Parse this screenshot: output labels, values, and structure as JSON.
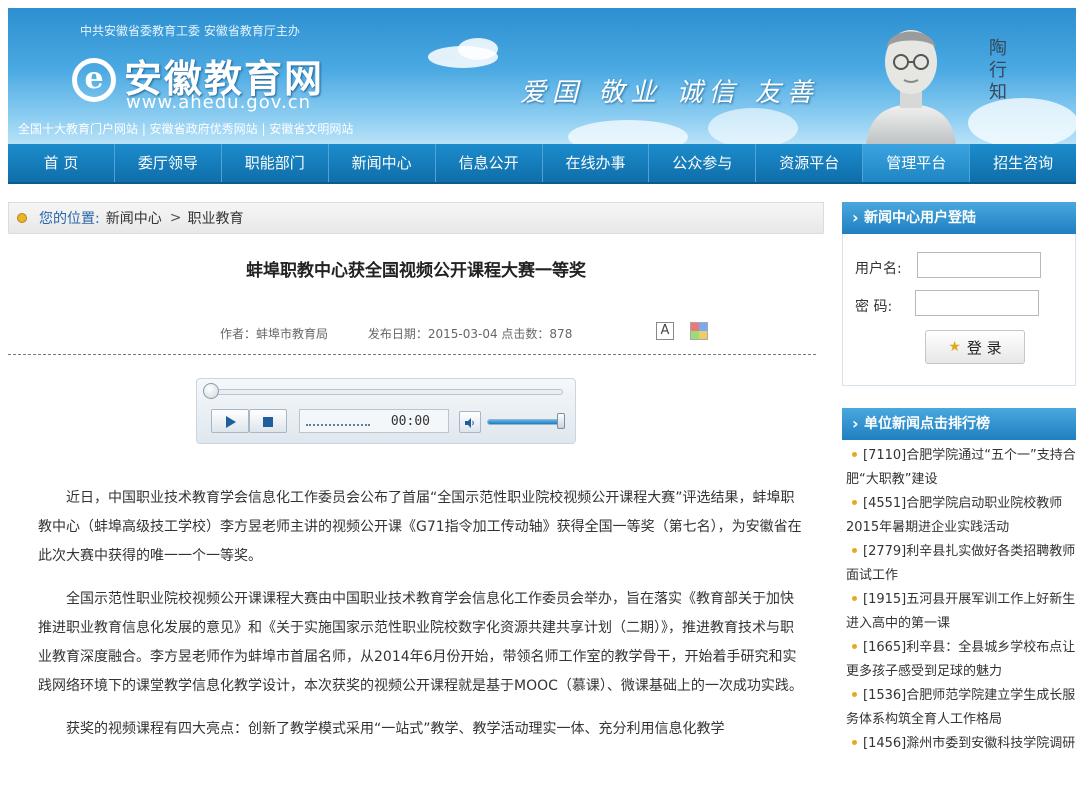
{
  "header": {
    "sponsor": "中共安徽省委教育工委  安徽省教育厅主办",
    "logo_mark": "e",
    "logo_text": "安徽教育网",
    "logo_url": "www.ahedu.gov.cn",
    "honors": "全国十大教育门户网站  |  安徽省政府优秀网站  |  安徽省文明网站",
    "slogan": "爱国 敬业 诚信 友善",
    "bust_name": "陶行知"
  },
  "nav": [
    "首  页",
    "委厅领导",
    "职能部门",
    "新闻中心",
    "信息公开",
    "在线办事",
    "公众参与",
    "资源平台",
    "管理平台",
    "招生咨询"
  ],
  "nav_active_index": 8,
  "breadcrumb": {
    "label": "您的位置:",
    "path1": "新闻中心",
    "sep": ">",
    "path2": "职业教育"
  },
  "article": {
    "title": "蚌埠职教中心获全国视频公开课程大赛一等奖",
    "author": "作者：蚌埠市教育局",
    "date": "发布日期：2015-03-04",
    "hits": "点击数：878",
    "font_icon": "A",
    "paragraphs": [
      "近日，中国职业技术教育学会信息化工作委员会公布了首届“全国示范性职业院校视频公开课程大赛”评选结果，蚌埠职教中心（蚌埠高级技工学校）李方昱老师主讲的视频公开课《G71指令加工传动轴》获得全国一等奖（第七名），为安徽省在此次大赛中获得的唯一一个一等奖。",
      "全国示范性职业院校视频公开课课程大赛由中国职业技术教育学会信息化工作委员会举办，旨在落实《教育部关于加快推进职业教育信息化发展的意见》和《关于实施国家示范性职业院校数字化资源共建共享计划（二期）》，推进教育技术与职业教育深度融合。李方昱老师作为蚌埠市首届名师，从2014年6月份开始，带领名师工作室的教学骨干，开始着手研究和实践网络环境下的课堂教学信息化教学设计，本次获奖的视频公开课程就是基于MOOC（慕课）、微课基础上的一次成功实践。",
      "获奖的视频课程有四大亮点：创新了教学模式采用“一站式”教学、教学活动理实一体、充分利用信息化教学"
    ]
  },
  "player": {
    "time": "00:00",
    "progress": 0,
    "volume": 1.0
  },
  "login": {
    "title": "新闻中心用户登陆",
    "username_label": "用户名:",
    "password_label": "密  码:",
    "username_value": "",
    "password_value": "",
    "button_label": "登 录"
  },
  "ranking": {
    "title": "单位新闻点击排行榜",
    "items": [
      "[7110]合肥学院通过“五个一”支持合肥“大职教”建设",
      "[4551]合肥学院启动职业院校教师2015年暑期进企业实践活动",
      "[2779]利辛县扎实做好各类招聘教师面试工作",
      "[1915]五河县开展军训工作上好新生进入高中的第一课",
      "[1665]利辛县：全县城乡学校布点让更多孩子感受到足球的魅力",
      "[1536]合肥师范学院建立学生成长服务体系构筑全育人工作格局",
      "[1456]滁州市委到安徽科技学院调研"
    ]
  },
  "colors": {
    "nav_bg": "#0f6eaa",
    "side_head_bg": "#1f7fc0",
    "bullet": "#e6a823",
    "link": "#2766a8"
  }
}
